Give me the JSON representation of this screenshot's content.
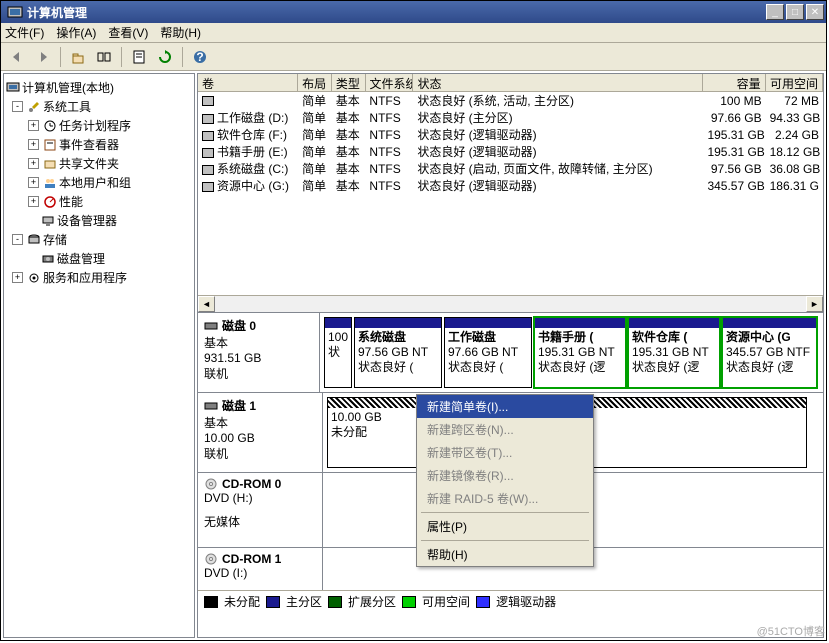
{
  "window": {
    "title": "计算机管理"
  },
  "menu": {
    "file": "文件(F)",
    "action": "操作(A)",
    "view": "查看(V)",
    "help": "帮助(H)"
  },
  "tree": {
    "root": "计算机管理(本地)",
    "systools": "系统工具",
    "task": "任务计划程序",
    "events": "事件查看器",
    "shared": "共享文件夹",
    "users": "本地用户和组",
    "perf": "性能",
    "devmgr": "设备管理器",
    "storage": "存储",
    "diskmgmt": "磁盘管理",
    "services": "服务和应用程序"
  },
  "columns": {
    "vol": "卷",
    "layout": "布局",
    "type": "类型",
    "fs": "文件系统",
    "status": "状态",
    "cap": "容量",
    "free": "可用空间"
  },
  "volumes": [
    {
      "name": "",
      "layout": "简单",
      "type": "基本",
      "fs": "NTFS",
      "status": "状态良好 (系统, 活动, 主分区)",
      "cap": "100 MB",
      "free": "72 MB"
    },
    {
      "name": "工作磁盘 (D:)",
      "layout": "简单",
      "type": "基本",
      "fs": "NTFS",
      "status": "状态良好 (主分区)",
      "cap": "97.66 GB",
      "free": "94.33 GB"
    },
    {
      "name": "软件仓库 (F:)",
      "layout": "简单",
      "type": "基本",
      "fs": "NTFS",
      "status": "状态良好 (逻辑驱动器)",
      "cap": "195.31 GB",
      "free": "2.24 GB"
    },
    {
      "name": "书籍手册 (E:)",
      "layout": "简单",
      "type": "基本",
      "fs": "NTFS",
      "status": "状态良好 (逻辑驱动器)",
      "cap": "195.31 GB",
      "free": "18.12 GB"
    },
    {
      "name": "系统磁盘 (C:)",
      "layout": "简单",
      "type": "基本",
      "fs": "NTFS",
      "status": "状态良好 (启动, 页面文件, 故障转储, 主分区)",
      "cap": "97.56 GB",
      "free": "36.08 GB"
    },
    {
      "name": "资源中心 (G:)",
      "layout": "简单",
      "type": "基本",
      "fs": "NTFS",
      "status": "状态良好 (逻辑驱动器)",
      "cap": "345.57 GB",
      "free": "186.31 G"
    }
  ],
  "disk0": {
    "title": "磁盘 0",
    "type": "基本",
    "size": "931.51 GB",
    "status": "联机",
    "p0l1": "100",
    "p0l2": "状",
    "p1l1": "系统磁盘",
    "p1l2": "97.56 GB NT",
    "p1l3": "状态良好 (",
    "p2l1": "工作磁盘",
    "p2l2": "97.66 GB NT",
    "p2l3": "状态良好 (",
    "p3l1": "书籍手册   (",
    "p3l2": "195.31 GB NT",
    "p3l3": "状态良好 (逻",
    "p4l1": "软件仓库   (",
    "p4l2": "195.31 GB NT",
    "p4l3": "状态良好 (逻",
    "p5l1": "资源中心   (G",
    "p5l2": "345.57 GB NTF",
    "p5l3": "状态良好 (逻"
  },
  "disk1": {
    "title": "磁盘 1",
    "type": "基本",
    "size": "10.00 GB",
    "status": "联机",
    "p0l1": "10.00 GB",
    "p0l2": "未分配"
  },
  "cdrom0": {
    "title": "CD-ROM 0",
    "drv": "DVD (H:)",
    "status": "无媒体"
  },
  "cdrom1": {
    "title": "CD-ROM 1",
    "drv": "DVD (I:)"
  },
  "ctx": {
    "simple": "新建简单卷(I)...",
    "span": "新建跨区卷(N)...",
    "stripe": "新建带区卷(T)...",
    "mirror": "新建镜像卷(R)...",
    "raid5": "新建 RAID-5 卷(W)...",
    "props": "属性(P)",
    "help": "帮助(H)"
  },
  "legend": {
    "unalloc": "未分配",
    "primary": "主分区",
    "ext": "扩展分区",
    "free": "可用空间",
    "logical": "逻辑驱动器"
  },
  "watermark": "@51CTO博客"
}
